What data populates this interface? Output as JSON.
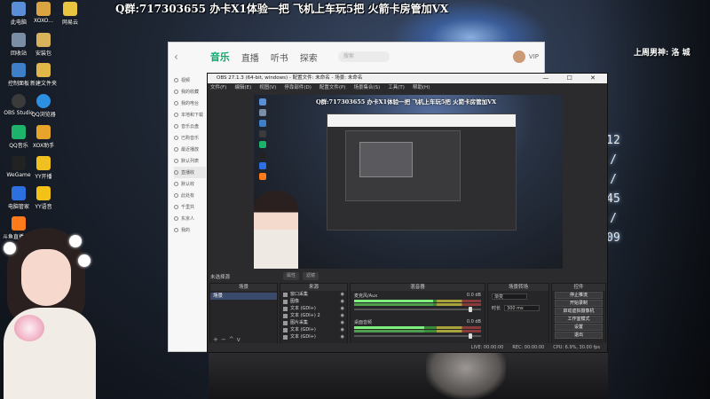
{
  "overlay": {
    "top_banner": "Q群:717303655   办卡X1体验一把   飞机上车玩5把   火箭卡房管加VX",
    "side_text": "上周男神: 洛 城",
    "clock": [
      "12",
      "/",
      "/",
      "45",
      "/",
      "09"
    ]
  },
  "desktop": {
    "icons": [
      {
        "label": "此电脑",
        "color": "#5a8fd8"
      },
      {
        "label": "XOXO...",
        "color": "#d9a441"
      },
      {
        "label": "网易云",
        "color": "#e8c440"
      },
      {
        "label": "回收站",
        "color": "#7a8fa5"
      },
      {
        "label": "安装包",
        "color": "#d9b25c"
      },
      {
        "label": "控制面板",
        "color": "#3d7fc9"
      },
      {
        "label": "新建文件夹",
        "color": "#e0b84a"
      },
      {
        "label": "OBS Studio",
        "color": "#3b3b3b"
      },
      {
        "label": "QQ浏览器",
        "color": "#2d8fe0"
      },
      {
        "label": "QQ音乐",
        "color": "#1eb36b"
      },
      {
        "label": "XOX助手",
        "color": "#e7a42b"
      },
      {
        "label": "WeGame",
        "color": "#222222"
      },
      {
        "label": "YY开播",
        "color": "#f0c020"
      },
      {
        "label": "电脑管家",
        "color": "#2c6fe0"
      },
      {
        "label": "YY语音",
        "color": "#f2c316"
      },
      {
        "label": "斗鱼直播伴侣",
        "color": "#ff7a1a"
      },
      {
        "label": "直播",
        "color": "#e14848"
      }
    ]
  },
  "music_app": {
    "tabs": [
      "音乐",
      "直播",
      "听书",
      "探索"
    ],
    "active_tab": "音乐",
    "search_placeholder": "搜索",
    "user_badge": "VIP",
    "sidebar": [
      "视频",
      "我的收藏",
      "我的电台",
      "本地和下载",
      "音乐云盘",
      "已购音乐",
      "最近播放",
      "默认列表",
      "直播收",
      "默认收",
      "此处有",
      "千里共",
      "东京人",
      "我的"
    ]
  },
  "obs": {
    "title": "OBS 27.1.3 (64-bit, windows) - 配置文件: 未命名 - 场景: 未命名",
    "menu": [
      "文件(F)",
      "编辑(E)",
      "视图(V)",
      "停靠部件(D)",
      "配置文件(P)",
      "场景集合(S)",
      "工具(T)",
      "帮助(H)"
    ],
    "window_controls": "— ☐ ✕",
    "preview_text": "Q群:717303655  办卡X1体验一把   飞机上车玩5把   火箭卡房管加VX",
    "no_source_label": "未选择源",
    "scene_buttons": [
      "属性",
      "滤镜"
    ],
    "docks": {
      "scenes_title": "场景",
      "sources_title": "来源",
      "mixer_title": "混音器",
      "transitions_title": "场景转场",
      "controls_title": "控件"
    },
    "scenes": [
      "场景"
    ],
    "sources": [
      "窗口采集",
      "图像",
      "文本 (GDI+)",
      "文本 (GDI+) 2",
      "图片采集",
      "文本 (GDI+)",
      "文本 (GDI+)"
    ],
    "mixer": [
      {
        "name": "麦克风/Aux",
        "db": "0.0 dB",
        "level": 0.62
      },
      {
        "name": "桌面音频",
        "db": "0.0 dB",
        "level": 0.55
      }
    ],
    "transitions": {
      "type": "渐变",
      "duration_label": "时长",
      "duration": "300 ms"
    },
    "controls": [
      "停止推流",
      "开始录制",
      "启动虚拟摄像机",
      "工作室模式",
      "设置",
      "退出"
    ],
    "status": {
      "live": "LIVE: 00:00:00",
      "rec": "REC: 00:00:00",
      "cpu": "CPU: 6.9%, 30.00 fps"
    }
  }
}
